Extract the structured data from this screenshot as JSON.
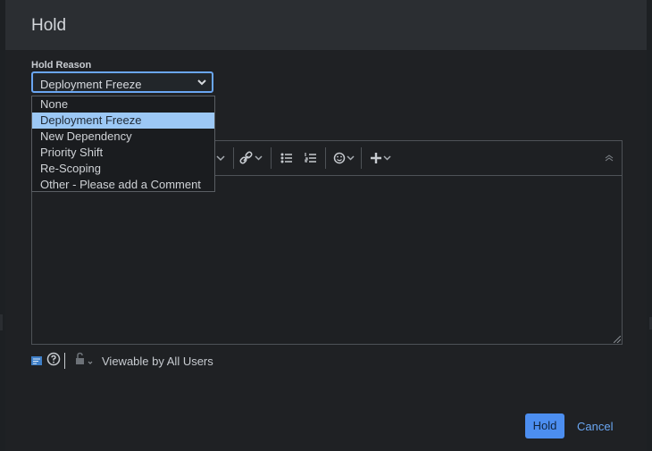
{
  "dialog": {
    "title": "Hold"
  },
  "hold_reason": {
    "label": "Hold Reason",
    "selected": "Deployment Freeze",
    "options": [
      "None",
      "Deployment Freeze",
      "New Dependency",
      "Priority Shift",
      "Re-Scoping",
      "Other - Please add a Comment"
    ],
    "selected_index": 1
  },
  "editor": {
    "toolbar_icons": [
      "chevron-down-icon",
      "link-icon",
      "bullet-list-icon",
      "numbered-list-icon",
      "emoji-icon",
      "plus-icon",
      "collapse-icon"
    ],
    "value": ""
  },
  "comment_footer": {
    "icons": [
      "editor-mode-icon",
      "help-icon",
      "lock-icon"
    ],
    "visibility": "Viewable by All Users"
  },
  "actions": {
    "primary": "Hold",
    "cancel": "Cancel"
  },
  "colors": {
    "accent": "#4c8ef0",
    "selected_option": "#9cc8f5",
    "dialog_bg": "#1f2124",
    "header_bg": "#2b2e32"
  }
}
